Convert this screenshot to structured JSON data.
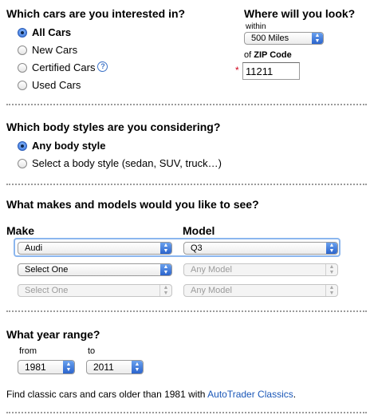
{
  "cars_question": "Which cars are you interested in?",
  "car_options": [
    {
      "label": "All Cars",
      "checked": true
    },
    {
      "label": "New Cars",
      "checked": false
    },
    {
      "label": "Certified Cars",
      "checked": false
    },
    {
      "label": "Used Cars",
      "checked": false
    }
  ],
  "help_glyph": "?",
  "location": {
    "title": "Where will you look?",
    "within_label": "within",
    "distance_value": "500 Miles",
    "required_mark": "*",
    "zip_prefix": "of",
    "zip_label": "ZIP Code",
    "zip_value": "11211"
  },
  "body_question": "Which body styles are you considering?",
  "body_options": [
    {
      "label": "Any body style",
      "checked": true
    },
    {
      "label": "Select a body style (sedan, SUV, truck…)",
      "checked": false
    }
  ],
  "makes_question": "What makes and models would you like to see?",
  "make_header": "Make",
  "model_header": "Model",
  "make_rows": [
    {
      "make": "Audi",
      "model": "Q3"
    },
    {
      "make": "Select One",
      "model": "Any Model"
    },
    {
      "make": "Select One",
      "model": "Any Model"
    }
  ],
  "year": {
    "question": "What year range?",
    "from_label": "from",
    "from_value": "1981",
    "to_label": "to",
    "to_value": "2011"
  },
  "footer": {
    "text": "Find classic cars and cars older than 1981 with ",
    "link": "AutoTrader Classics",
    "period": "."
  }
}
